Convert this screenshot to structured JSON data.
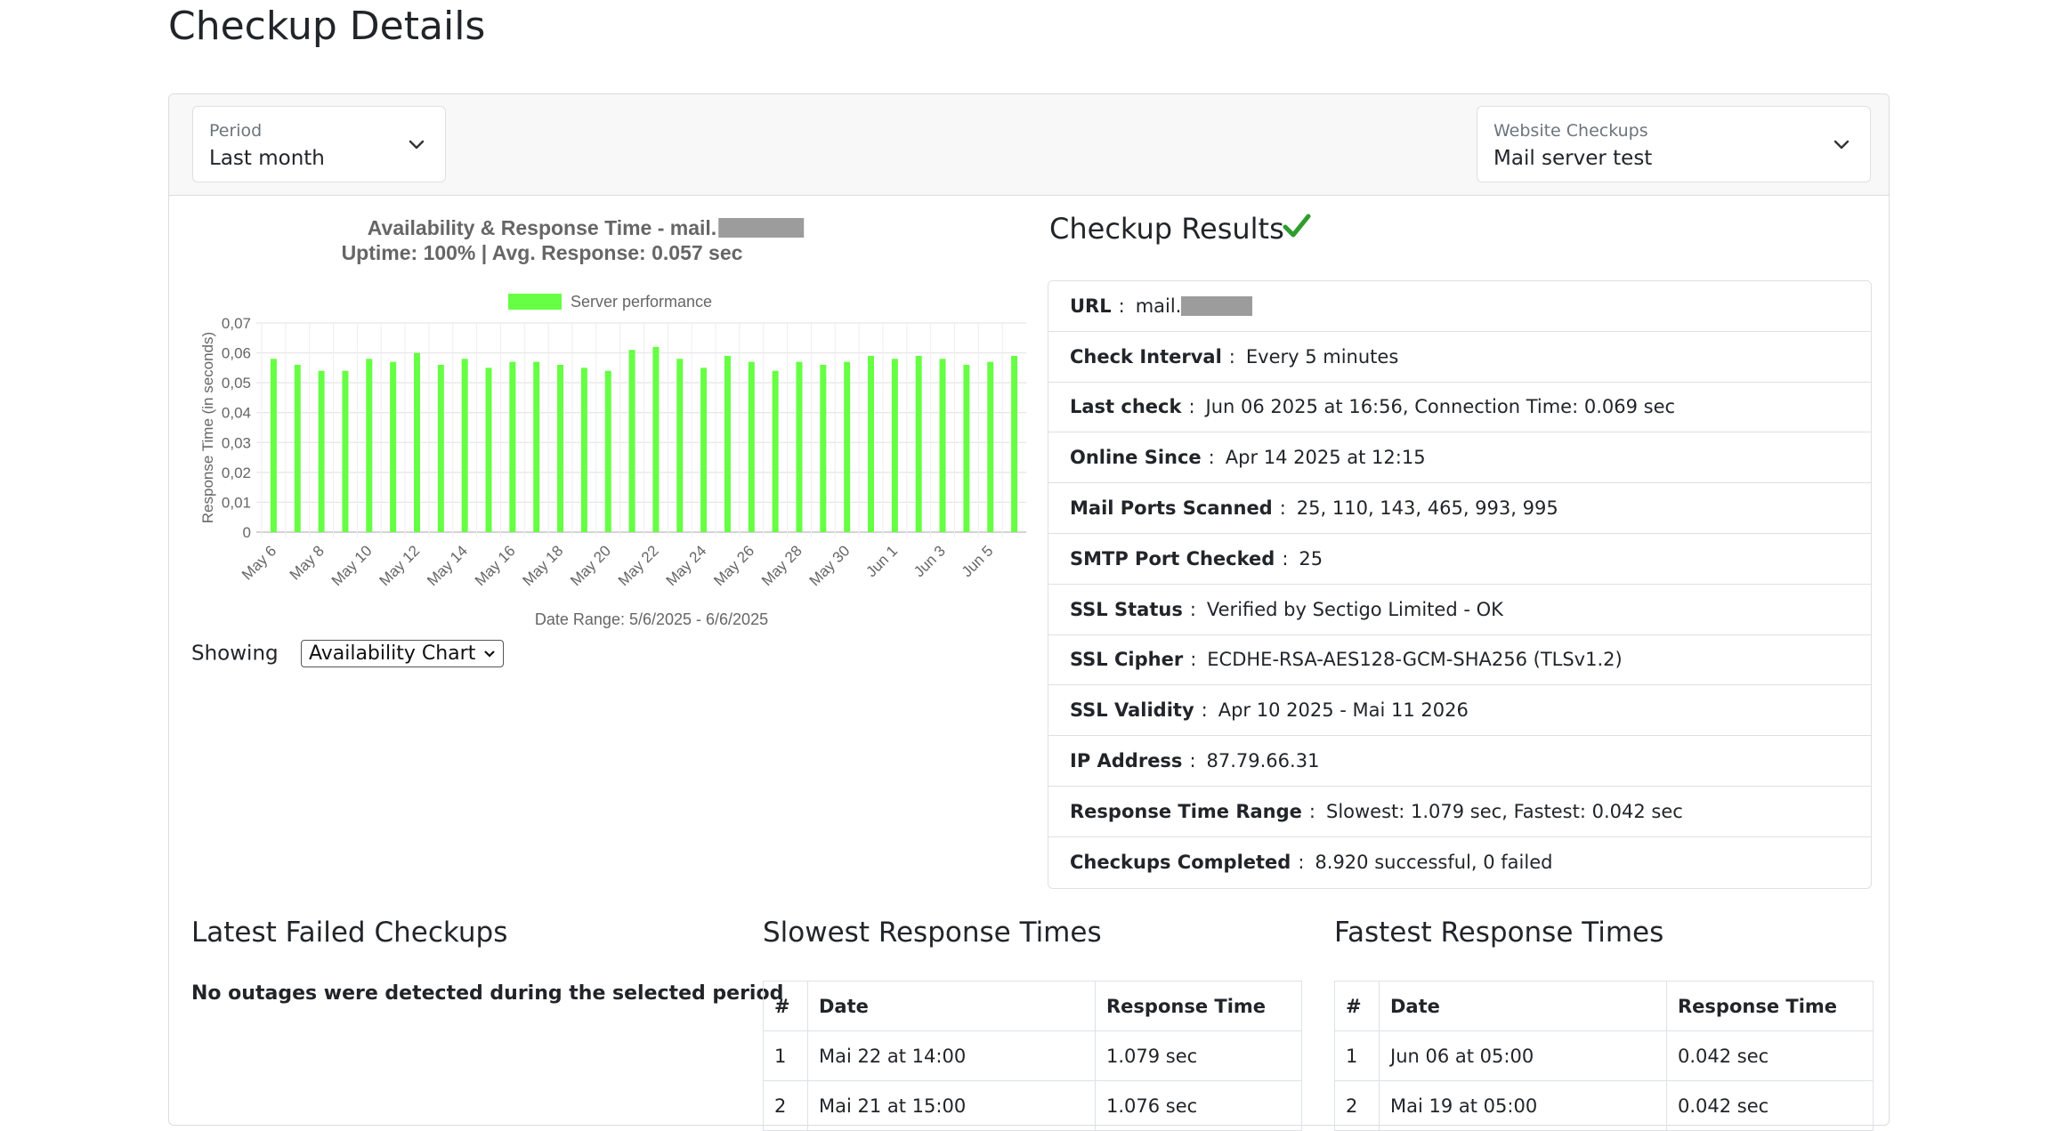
{
  "page": {
    "title": "Checkup Details"
  },
  "filters": {
    "period": {
      "label": "Period",
      "value": "Last month"
    },
    "checkup": {
      "label": "Website Checkups",
      "value": "Mail server test"
    }
  },
  "chart_data": {
    "type": "bar",
    "title": "Availability & Response Time - mail.",
    "subtitle": "Uptime:  100% | Avg. Response: 0.057 sec",
    "xlabel": "Date Range: 5/6/2025 - 6/6/2025",
    "ylabel": "Response Time (in seconds)",
    "ylim": [
      0,
      0.07
    ],
    "yticks": [
      "0",
      "0,01",
      "0,02",
      "0,03",
      "0,04",
      "0,05",
      "0,06",
      "0,07"
    ],
    "ytick_values": [
      0,
      0.01,
      0.02,
      0.03,
      0.04,
      0.05,
      0.06,
      0.07
    ],
    "grid": true,
    "legend_position": "top",
    "series": [
      {
        "name": "Server performance",
        "color": "#66ff44",
        "values": [
          0.058,
          0.056,
          0.054,
          0.054,
          0.058,
          0.057,
          0.06,
          0.056,
          0.058,
          0.055,
          0.057,
          0.057,
          0.056,
          0.055,
          0.054,
          0.061,
          0.062,
          0.058,
          0.055,
          0.059,
          0.057,
          0.054,
          0.057,
          0.056,
          0.057,
          0.059,
          0.058,
          0.059,
          0.058,
          0.056,
          0.057,
          0.059
        ]
      }
    ],
    "x_tick_labels": [
      "May 6",
      "May 8",
      "May 10",
      "May 12",
      "May 14",
      "May 16",
      "May 18",
      "May 20",
      "May 22",
      "May 24",
      "May 26",
      "May 28",
      "May 30",
      "Jun 1",
      "Jun 3",
      "Jun 5"
    ]
  },
  "chart_controls": {
    "showing_label": "Showing",
    "selected": "Availability Chart"
  },
  "results": {
    "title": "Checkup Results",
    "status_icon": "check-icon",
    "status_color": "#2e9d2e",
    "rows": [
      {
        "key": "URL",
        "value": "mail."
      },
      {
        "key": "Check Interval",
        "value": "Every 5 minutes"
      },
      {
        "key": "Last check",
        "value": "Jun 06 2025 at 16:56, Connection Time: 0.069 sec"
      },
      {
        "key": "Online Since",
        "value": "Apr 14 2025 at 12:15"
      },
      {
        "key": "Mail Ports Scanned",
        "value": "25, 110, 143, 465, 993, 995"
      },
      {
        "key": "SMTP Port Checked",
        "value": "25"
      },
      {
        "key": "SSL Status",
        "value": "Verified by Sectigo Limited - OK"
      },
      {
        "key": "SSL Cipher",
        "value": "ECDHE-RSA-AES128-GCM-SHA256 (TLSv1.2)"
      },
      {
        "key": "SSL Validity",
        "value": "Apr 10 2025 - Mai 11 2026"
      },
      {
        "key": "IP Address",
        "value": "87.79.66.31"
      },
      {
        "key": "Response Time Range",
        "value": "Slowest: 1.079 sec, Fastest: 0.042 sec"
      },
      {
        "key": "Checkups Completed",
        "value": "8.920 successful, 0 failed"
      }
    ]
  },
  "failed": {
    "title": "Latest Failed Checkups",
    "message": "No outages were detected during the selected period"
  },
  "slowest": {
    "title": "Slowest Response Times",
    "columns": [
      "#",
      "Date",
      "Response Time"
    ],
    "rows": [
      [
        "1",
        "Mai 22 at 14:00",
        "1.079 sec"
      ],
      [
        "2",
        "Mai 21 at 15:00",
        "1.076 sec"
      ]
    ]
  },
  "fastest": {
    "title": "Fastest Response Times",
    "columns": [
      "#",
      "Date",
      "Response Time"
    ],
    "rows": [
      [
        "1",
        "Jun 06 at 05:00",
        "0.042 sec"
      ],
      [
        "2",
        "Mai 19 at 05:00",
        "0.042 sec"
      ]
    ]
  }
}
